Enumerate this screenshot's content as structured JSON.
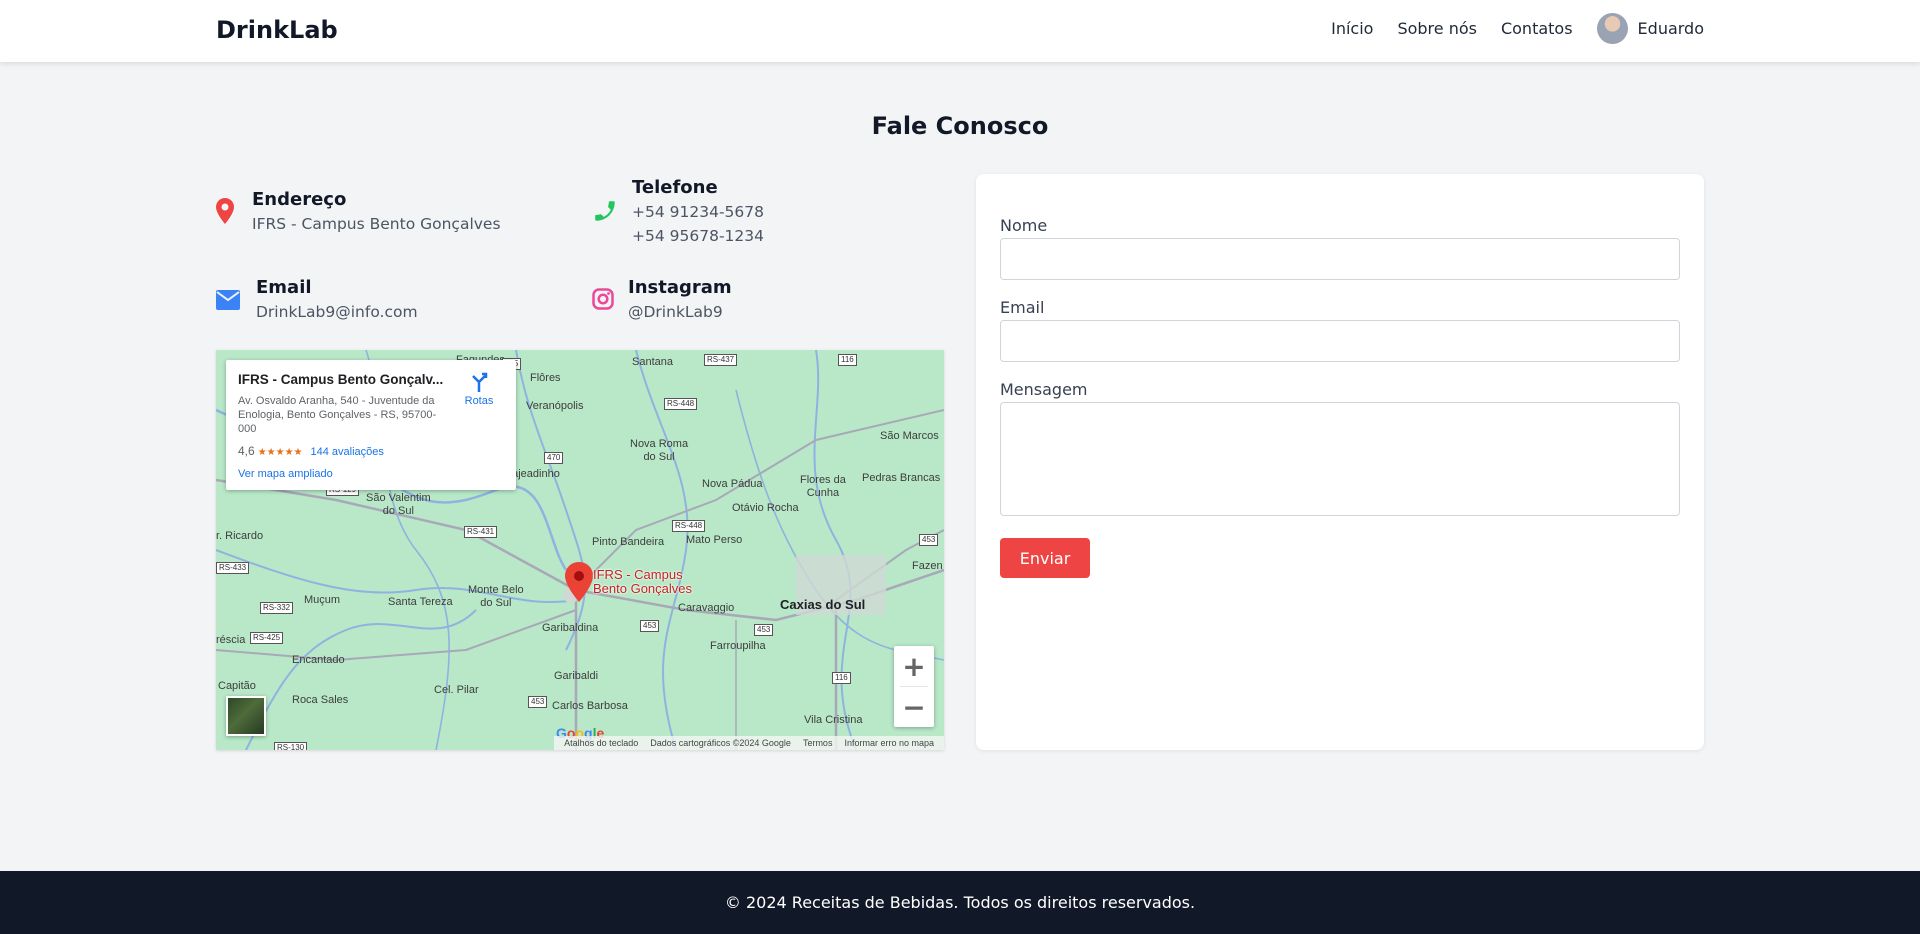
{
  "header": {
    "brand": "DrinkLab",
    "nav": [
      "Início",
      "Sobre nós",
      "Contatos"
    ],
    "user_name": "Eduardo"
  },
  "page_title": "Fale Conosco",
  "contact": {
    "address": {
      "title": "Endereço",
      "value": "IFRS - Campus Bento Gonçalves",
      "icon": "map-pin-icon",
      "color": "#ef4444"
    },
    "phone": {
      "title": "Telefone",
      "lines": [
        "+54 91234-5678",
        "+54 95678-1234"
      ],
      "icon": "phone-icon",
      "color": "#22c55e"
    },
    "email": {
      "title": "Email",
      "value": "DrinkLab9@info.com",
      "icon": "envelope-icon",
      "color": "#3b82f6"
    },
    "instagram": {
      "title": "Instagram",
      "value": "@DrinkLab9",
      "icon": "instagram-icon",
      "color": "#ec4899"
    }
  },
  "map": {
    "place_name": "IFRS - Campus Bento Gonçalv...",
    "address": "Av. Osvaldo Aranha, 540 - Juventude da Enologia, Bento Gonçalves - RS, 95700-000",
    "rating": "4,6",
    "stars": "★★★★★",
    "reviews": "144 avaliações",
    "view_larger": "Ver mapa ampliado",
    "directions": "Rotas",
    "pin_label_1": "IFRS - Campus",
    "pin_label_2": "Bento Gonçalves",
    "google": "Google",
    "attribution": [
      "Atalhos do teclado",
      "Dados cartográficos ©2024 Google",
      "Termos",
      "Informar erro no mapa"
    ],
    "places": {
      "fagundes": "Fagundes",
      "flores": "Flôres",
      "santana": "Santana",
      "veranopolis": "Veranópolis",
      "nova_roma_1": "Nova Roma",
      "nova_roma_2": "do Sul",
      "sao_marcos": "São Marcos",
      "lajeadinho": "Lajeadinho",
      "nova_padua": "Nova Pádua",
      "flores_cunha_1": "Flores da",
      "flores_cunha_2": "Cunha",
      "pedras_brancas": "Pedras Brancas",
      "sao_valentim_1": "São Valentim",
      "sao_valentim_2": "do Sul",
      "otavio_rocha": "Otávio Rocha",
      "ricardo": "r. Ricardo",
      "pinto_bandeira": "Pinto Bandeira",
      "mato_perso": "Mato Perso",
      "fazenda": "Fazen",
      "monte_belo_1": "Monte Belo",
      "monte_belo_2": "do Sul",
      "mucum": "Muçum",
      "santa_tereza": "Santa Tereza",
      "caravaggio": "Caravaggio",
      "caxias": "Caxias do Sul",
      "garibaldina": "Garibaldina",
      "brescia": "réscia",
      "farroupilha": "Farroupilha",
      "encantado": "Encantado",
      "garibaldi": "Garibaldi",
      "capitao": "Capitão",
      "cel_pilar": "Cel. Pilar",
      "roca_sales": "Roca Sales",
      "carlos_barbosa": "Carlos Barbosa",
      "vila_cristina": "Vila Cristina"
    },
    "roads": {
      "r355": "355",
      "r437": "RS-437",
      "r116a": "116",
      "r448a": "RS-448",
      "r470": "470",
      "r129": "RS-129",
      "r431": "RS-431",
      "r448b": "RS-448",
      "r453a": "453",
      "r433": "RS-433",
      "r332": "RS-332",
      "r425": "RS-425",
      "r453b": "453",
      "r453c": "453",
      "r116b": "116",
      "r453d": "453",
      "r130": "RS-130"
    }
  },
  "form": {
    "name_label": "Nome",
    "email_label": "Email",
    "message_label": "Mensagem",
    "submit": "Enviar"
  },
  "footer": "© 2024 Receitas de Bebidas. Todos os direitos reservados."
}
